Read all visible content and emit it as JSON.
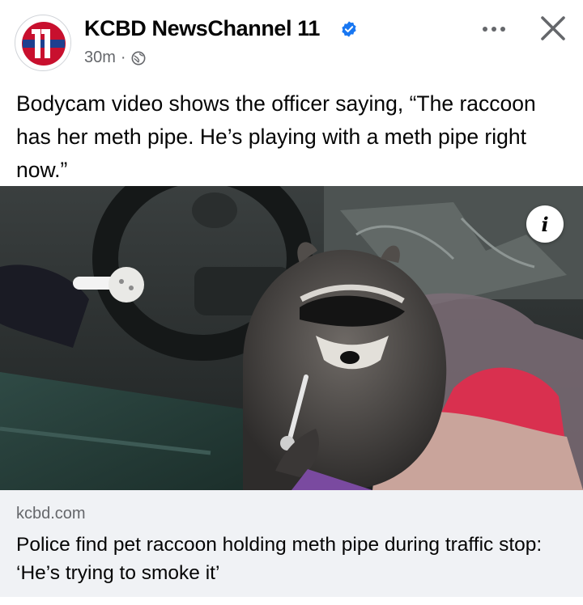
{
  "post": {
    "page_name": "KCBD NewsChannel 11",
    "time_ago": "30m",
    "separator": "·",
    "body_text": "Bodycam video shows the officer saying, “The raccoon has her meth pipe. He’s playing with a meth pipe right now.”"
  },
  "icons": {
    "avatar": "kcbd-logo",
    "verified": "verified-badge-icon",
    "privacy": "globe-icon",
    "more": "more-options-icon",
    "close": "close-icon",
    "info": "info-icon"
  },
  "colors": {
    "brand_red": "#c8102e",
    "brand_blue": "#1d3f8f",
    "verified_blue": "#1877f2",
    "secondary_text": "#65676b",
    "preview_bg": "#f0f2f5"
  },
  "link_preview": {
    "domain": "kcbd.com",
    "title": "Police find pet raccoon holding meth pipe during traffic stop: ‘He’s trying to smoke it’"
  },
  "media": {
    "info_glyph": "i"
  }
}
